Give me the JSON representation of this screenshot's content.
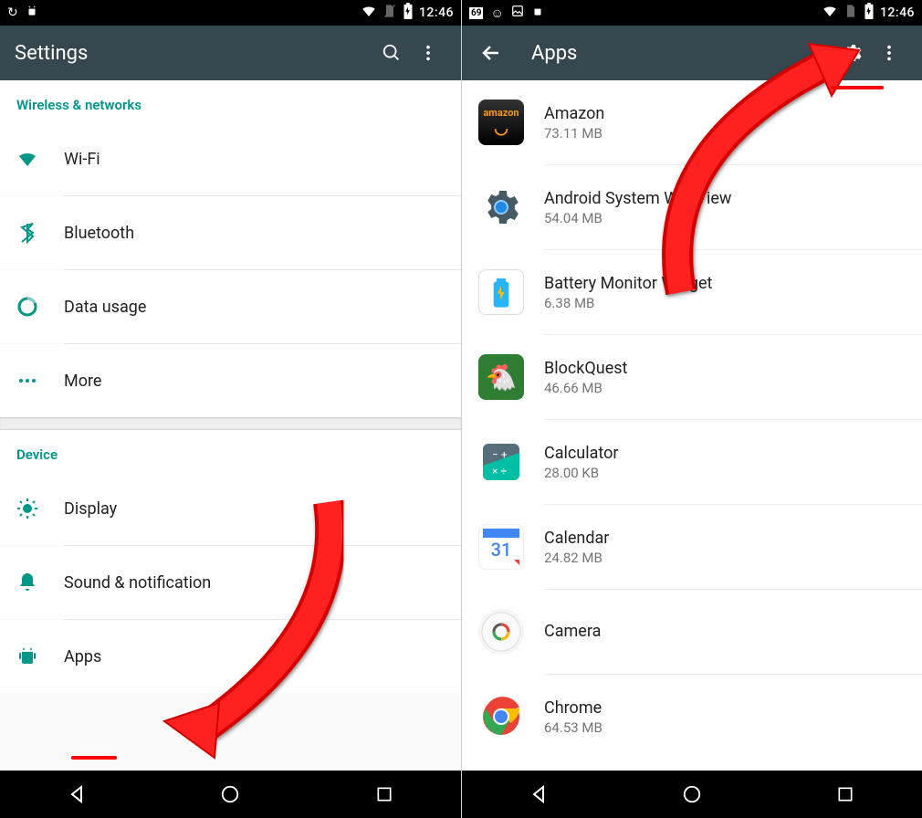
{
  "status": {
    "left_icons": [
      "↻",
      "⋮⋮"
    ],
    "left_icons2": [
      "69",
      "☺",
      "▢",
      "⋮⋮"
    ],
    "clock": "12:46"
  },
  "settings": {
    "title": "Settings",
    "sections": [
      {
        "header": "Wireless & networks",
        "items": [
          {
            "k": "wifi",
            "label": "Wi-Fi"
          },
          {
            "k": "bluetooth",
            "label": "Bluetooth"
          },
          {
            "k": "data",
            "label": "Data usage"
          },
          {
            "k": "more",
            "label": "More"
          }
        ]
      },
      {
        "header": "Device",
        "items": [
          {
            "k": "display",
            "label": "Display"
          },
          {
            "k": "sound",
            "label": "Sound & notification"
          },
          {
            "k": "apps",
            "label": "Apps"
          }
        ]
      }
    ]
  },
  "apps": {
    "title": "Apps",
    "items": [
      {
        "name": "Amazon",
        "size": "73.11 MB",
        "bg": "#f59e0b"
      },
      {
        "name": "Android System WebView",
        "size": "54.04 MB",
        "bg": "#455a64"
      },
      {
        "name": "Battery Monitor Widget",
        "size": "6.38 MB",
        "bg": "#2196f3"
      },
      {
        "name": "BlockQuest",
        "size": "46.66 MB",
        "bg": "#2e7d32"
      },
      {
        "name": "Calculator",
        "size": "28.00 KB",
        "bg": "#607d8b"
      },
      {
        "name": "Calendar",
        "size": "24.82 MB",
        "bg": "#ffffff"
      },
      {
        "name": "Camera",
        "size": "",
        "bg": "#eeeeee"
      },
      {
        "name": "Chrome",
        "size": "64.53 MB",
        "bg": "#ffffff"
      }
    ]
  }
}
